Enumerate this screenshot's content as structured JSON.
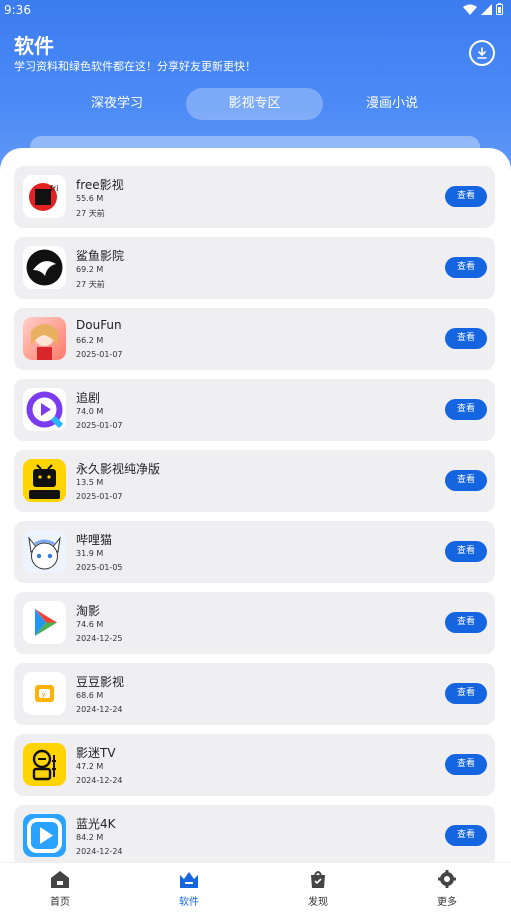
{
  "status": {
    "time": "9:36"
  },
  "header": {
    "title": "软件",
    "subtitle": "学习资料和绿色软件都在这！分享好友更新更快！"
  },
  "tabs": [
    {
      "label": "深夜学习"
    },
    {
      "label": "影视专区"
    },
    {
      "label": "漫画小说"
    }
  ],
  "apps": [
    {
      "name": "free影视",
      "size": "55.6 M",
      "date": "27 天前",
      "button": "查看",
      "icon": "free-video-icon"
    },
    {
      "name": "鲨鱼影院",
      "size": "69.2 M",
      "date": "27 天前",
      "button": "查看",
      "icon": "shark-cinema-icon"
    },
    {
      "name": "DouFun",
      "size": "66.2 M",
      "date": "2025-01-07",
      "button": "查看",
      "icon": "doufun-icon"
    },
    {
      "name": "追剧",
      "size": "74.0 M",
      "date": "2025-01-07",
      "button": "查看",
      "icon": "zhuiju-play-icon"
    },
    {
      "name": "永久影视纯净版",
      "size": "13.5 M",
      "date": "2025-01-07",
      "button": "查看",
      "icon": "tv-pure-icon",
      "badge": "纯净版"
    },
    {
      "name": "哔哩猫",
      "size": "31.9 M",
      "date": "2025-01-05",
      "button": "查看",
      "icon": "bilimao-icon"
    },
    {
      "name": "淘影",
      "size": "74.6 M",
      "date": "2024-12-25",
      "button": "查看",
      "icon": "taoying-play-icon"
    },
    {
      "name": "豆豆影视",
      "size": "68.6 M",
      "date": "2024-12-24",
      "button": "查看",
      "icon": "doudou-icon"
    },
    {
      "name": "影迷TV",
      "size": "47.2 M",
      "date": "2024-12-24",
      "button": "查看",
      "icon": "yingmi-tv-icon"
    },
    {
      "name": "蓝光4K",
      "size": "84.2 M",
      "date": "2024-12-24",
      "button": "查看",
      "icon": "bluray-play-icon"
    }
  ],
  "nav": [
    {
      "label": "首页",
      "icon": "home-icon"
    },
    {
      "label": "软件",
      "icon": "software-icon"
    },
    {
      "label": "发现",
      "icon": "discover-icon"
    },
    {
      "label": "更多",
      "icon": "gear-icon"
    }
  ],
  "colors": {
    "accent": "#1565e0",
    "header": "#3b7cf0",
    "card": "#efeff1"
  }
}
